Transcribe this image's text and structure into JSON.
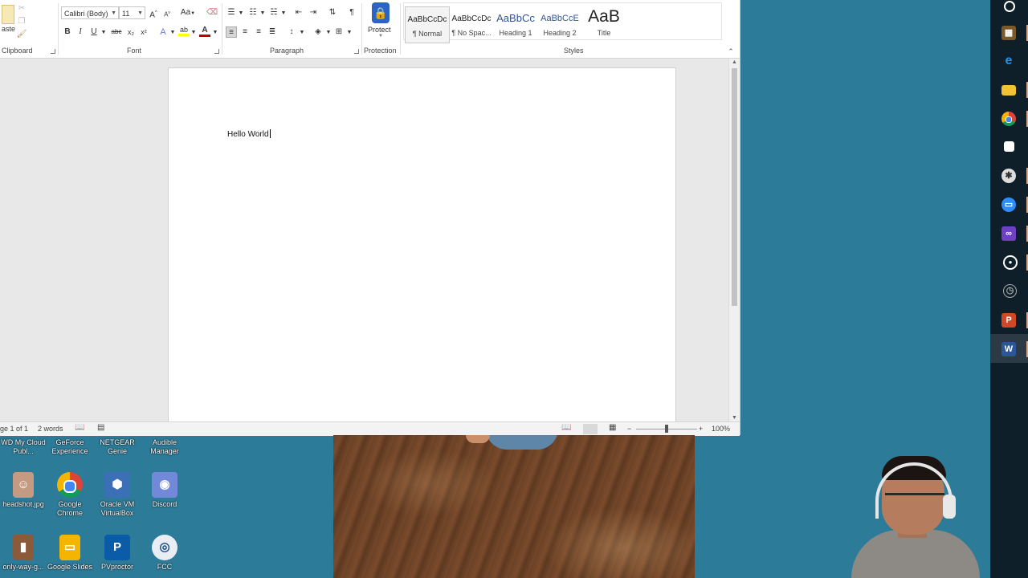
{
  "ribbon": {
    "groups": {
      "clipboard": "Clipboard",
      "font": "Font",
      "paragraph": "Paragraph",
      "protection": "Protection",
      "styles": "Styles"
    },
    "clipboard": {
      "paste_label": "aste"
    },
    "font": {
      "font_name": "Calibri (Body)",
      "font_size": "11",
      "change_case": "Aa",
      "bold": "B",
      "italic": "I",
      "underline": "U",
      "strikethrough": "abc",
      "subscript": "x₂",
      "superscript": "x²",
      "font_color_letter": "A",
      "font_color": "#c00000",
      "highlight_color": "#ffff00"
    },
    "protection": {
      "protect_label": "Protect"
    },
    "styles": [
      {
        "preview": "AaBbCcDc",
        "name": "¶ Normal"
      },
      {
        "preview": "AaBbCcDc",
        "name": "¶ No Spac..."
      },
      {
        "preview": "AaBbCc",
        "name": "Heading 1"
      },
      {
        "preview": "AaBbCcE",
        "name": "Heading 2"
      },
      {
        "preview": "AaB",
        "name": "Title"
      }
    ]
  },
  "document": {
    "text": "Hello World"
  },
  "statusbar": {
    "page": "ge 1 of 1",
    "words": "2 words",
    "zoom": "100%",
    "zoom_level": 0.5
  },
  "taskbar": {
    "icons": [
      "circle-icon",
      "minecraft-icon",
      "edge-icon",
      "file-explorer-icon",
      "chrome-icon",
      "sticky-notes-icon",
      "settings-icon",
      "zoom-icon",
      "visual-studio-icon",
      "obs-icon",
      "clock-icon",
      "powerpoint-icon",
      "word-icon"
    ]
  },
  "desktop": {
    "icons": [
      {
        "label": "WD My Cloud Publ...",
        "icon": "wd-icon"
      },
      {
        "label": "GeForce Experience",
        "icon": "geforce-icon"
      },
      {
        "label": "NETGEAR Genie",
        "icon": "netgear-icon"
      },
      {
        "label": "Audible Manager",
        "icon": "audible-icon"
      },
      {
        "label": "headshot.jpg",
        "icon": "image-icon"
      },
      {
        "label": "Google Chrome",
        "icon": "chrome-icon"
      },
      {
        "label": "Oracle VM VirtualBox",
        "icon": "virtualbox-icon"
      },
      {
        "label": "Discord",
        "icon": "discord-icon"
      },
      {
        "label": "only-way-g...",
        "icon": "book-icon"
      },
      {
        "label": "Google Slides",
        "icon": "google-slides-icon"
      },
      {
        "label": "PVproctor",
        "icon": "pvproctor-icon"
      },
      {
        "label": "FCC",
        "icon": "fcc-icon"
      }
    ]
  }
}
